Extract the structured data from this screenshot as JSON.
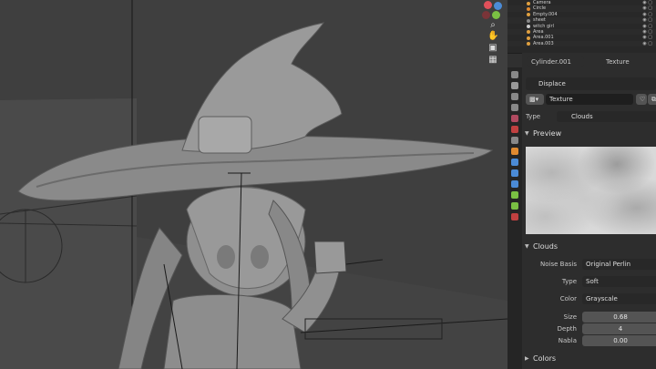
{
  "outliner": {
    "rows": [
      {
        "label": "Camera",
        "color": "#e0a040"
      },
      {
        "label": "Circle",
        "color": "#e08a30"
      },
      {
        "label": "Empty.004",
        "color": "#e0a040"
      },
      {
        "label": "sheet",
        "color": "#888888"
      },
      {
        "label": "witch girl",
        "color": "#cccccc"
      },
      {
        "label": "Area",
        "color": "#e0a040"
      },
      {
        "label": "Area.001",
        "color": "#e0a040"
      },
      {
        "label": "Area.003",
        "color": "#e0a040"
      }
    ]
  },
  "properties": {
    "header_left": "Cylinder.001",
    "header_right": "Texture",
    "modifier_name": "Displace",
    "texture_name": "Texture",
    "type_label": "Type",
    "type_value": "Clouds",
    "preview_label": "Preview",
    "clouds_label": "Clouds",
    "noise_basis_label": "Noise Basis",
    "noise_basis_value": "Original Perlin",
    "noise_type_label": "Type",
    "noise_type_value": "Soft",
    "color_label": "Color",
    "color_value": "Grayscale",
    "size_label": "Size",
    "size_value": "0.68",
    "depth_label": "Depth",
    "depth_value": "4",
    "nabla_label": "Nabla",
    "nabla_value": "0.00",
    "colors_label": "Colors"
  },
  "icons": {
    "x_axis": "#e0505a",
    "y_axis": "#7ac043",
    "z_axis": "#4b8bd6",
    "tool_icons": [
      "zoom-icon",
      "hand-icon",
      "camera-icon",
      "grid-icon"
    ]
  }
}
